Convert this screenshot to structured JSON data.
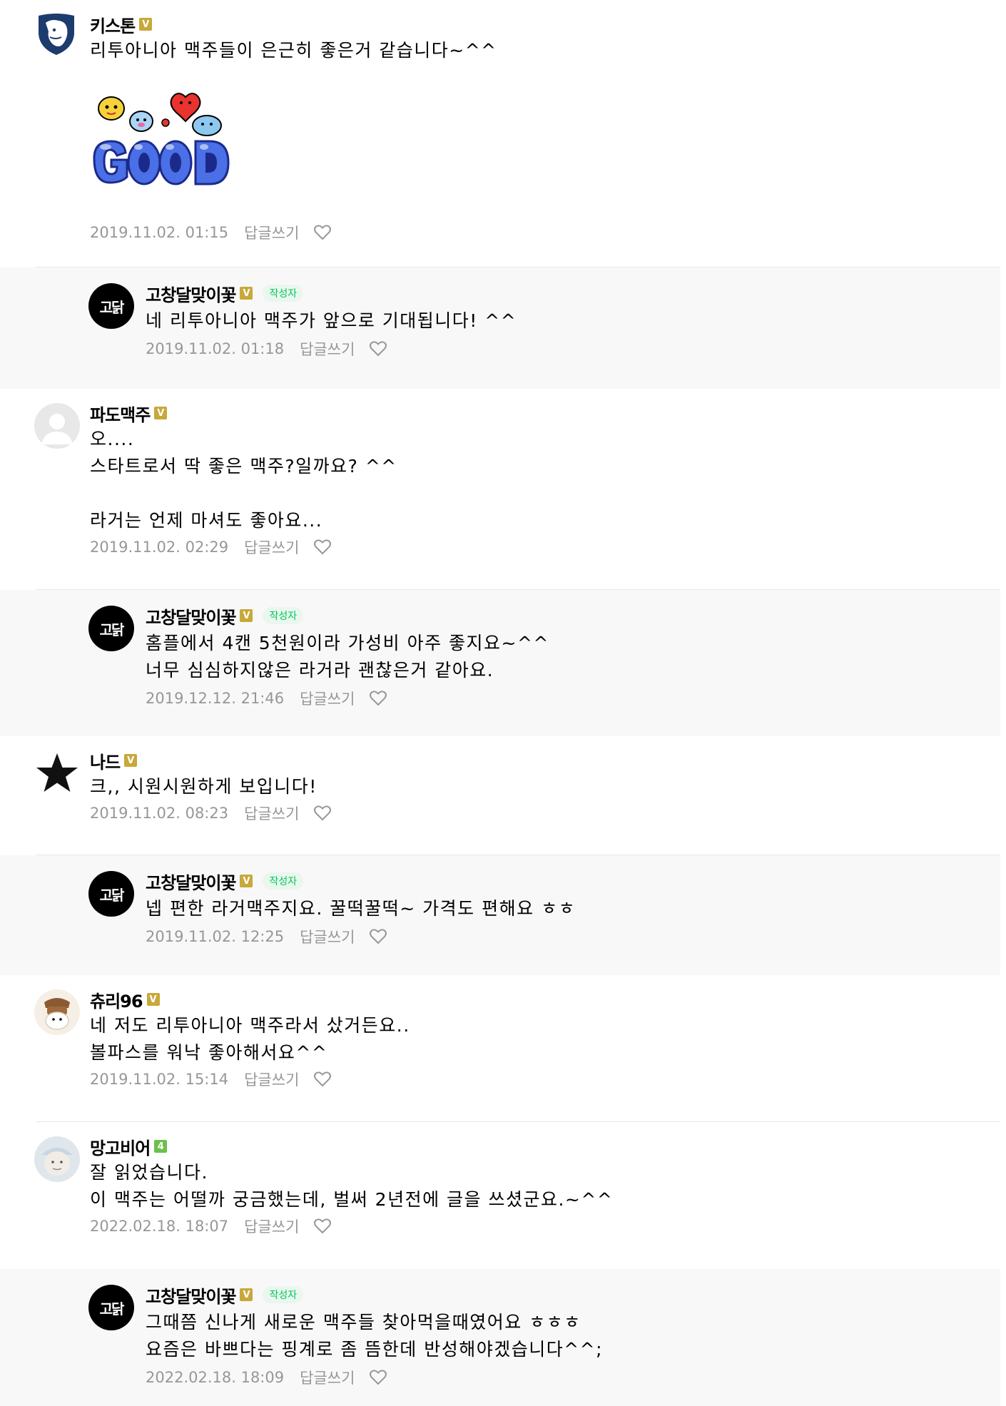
{
  "comments": [
    {
      "nickname": "키스톤",
      "badge": "V",
      "text": "리투아니아 맥주들이 은근히 좋은거 같습니다~^^",
      "sticker_text": "GOOD",
      "date": "2019.11.02. 01:15",
      "reply_label": "답글쓰기",
      "avatar_icon": "shield-lion-icon"
    },
    {
      "nickname": "고창달맞이꽃",
      "badge": "V",
      "author_tag": "작성자",
      "avatar_text": "고닭",
      "text": "네 리투아니아 맥주가 앞으로 기대됩니다! ^^",
      "date": "2019.11.02. 01:18",
      "reply_label": "답글쓰기"
    },
    {
      "nickname": "파도맥주",
      "badge": "V",
      "text": "오....\n스타트로서 딱 좋은 맥주?일까요? ^^\n\n라거는 언제 마셔도 좋아요...",
      "date": "2019.11.02. 02:29",
      "reply_label": "답글쓰기",
      "avatar_icon": "default-person-icon"
    },
    {
      "nickname": "고창달맞이꽃",
      "badge": "V",
      "author_tag": "작성자",
      "avatar_text": "고닭",
      "text": "홈플에서 4캔 5천원이라 가성비 아주 좋지요~^^\n너무 심심하지않은 라거라 괜찮은거 같아요.",
      "date": "2019.12.12. 21:46",
      "reply_label": "답글쓰기"
    },
    {
      "nickname": "나드",
      "badge": "V",
      "text": "크,, 시원시원하게 보입니다!",
      "date": "2019.11.02. 08:23",
      "reply_label": "답글쓰기",
      "avatar_icon": "star-icon"
    },
    {
      "nickname": "고창달맞이꽃",
      "badge": "V",
      "author_tag": "작성자",
      "avatar_text": "고닭",
      "text": "넵 편한 라거맥주지요. 꿀떡꿀떡~ 가격도 편해요 ㅎㅎ",
      "date": "2019.11.02. 12:25",
      "reply_label": "답글쓰기"
    },
    {
      "nickname": "츄리96",
      "badge": "V",
      "text": "네 저도 리투아니아 맥주라서 샀거든요..\n볼파스를 워낙 좋아해서요^^",
      "date": "2019.11.02. 15:14",
      "reply_label": "답글쓰기",
      "avatar_icon": "bear-icon"
    },
    {
      "nickname": "망고비어",
      "badge": "4",
      "text": "잘 읽었습니다.\n이 맥주는 어떨까 궁금했는데, 벌써 2년전에 글을 쓰셨군요.~^^",
      "date": "2022.02.18. 18:07",
      "reply_label": "답글쓰기",
      "avatar_icon": "face-icon"
    },
    {
      "nickname": "고창달맞이꽃",
      "badge": "V",
      "author_tag": "작성자",
      "avatar_text": "고닭",
      "text": "그때쯤 신나게 새로운 맥주들 찾아먹을때였어요 ㅎㅎㅎ\n요즘은 바쁘다는 핑계로 좀 뜸한데 반성해야겠습니다^^;",
      "date": "2022.02.18. 18:09",
      "reply_label": "답글쓰기"
    }
  ],
  "colors": {
    "reply_bg": "#f8f8f8",
    "meta_text": "#979797",
    "badge_gold": "#c8a83a",
    "badge_green": "#6cc04a",
    "author_tag_text": "#03c75a",
    "author_tag_bg": "#e9f7ee"
  }
}
